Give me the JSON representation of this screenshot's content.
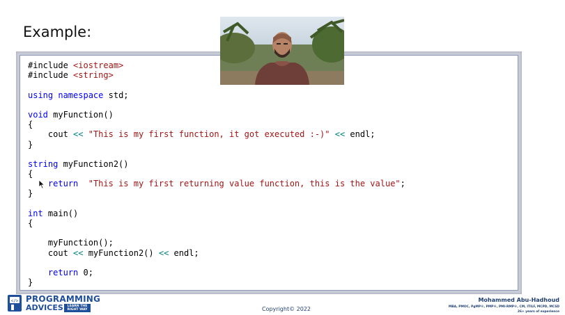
{
  "slide": {
    "title": "Example:"
  },
  "code": {
    "lines": [
      [
        {
          "t": "#include ",
          "c": "plain"
        },
        {
          "t": "<iostream>",
          "c": "str"
        }
      ],
      [
        {
          "t": "#include ",
          "c": "plain"
        },
        {
          "t": "<string>",
          "c": "str"
        }
      ],
      [],
      [
        {
          "t": "using",
          "c": "kw"
        },
        {
          "t": " ",
          "c": "plain"
        },
        {
          "t": "namespace",
          "c": "kw"
        },
        {
          "t": " std;",
          "c": "plain"
        }
      ],
      [],
      [
        {
          "t": "void",
          "c": "kw"
        },
        {
          "t": " myFunction()",
          "c": "plain"
        }
      ],
      [
        {
          "t": "{",
          "c": "plain"
        }
      ],
      [
        {
          "t": "    cout ",
          "c": "plain"
        },
        {
          "t": "<<",
          "c": "op"
        },
        {
          "t": " ",
          "c": "plain"
        },
        {
          "t": "\"This is my first function, it got executed :-)\"",
          "c": "str"
        },
        {
          "t": " ",
          "c": "plain"
        },
        {
          "t": "<<",
          "c": "op"
        },
        {
          "t": " endl;",
          "c": "plain"
        }
      ],
      [
        {
          "t": "}",
          "c": "plain"
        }
      ],
      [],
      [
        {
          "t": "string",
          "c": "kw"
        },
        {
          "t": " myFunction2()",
          "c": "plain"
        }
      ],
      [
        {
          "t": "{",
          "c": "plain"
        }
      ],
      [
        {
          "t": "    ",
          "c": "plain"
        },
        {
          "t": "return",
          "c": "kw"
        },
        {
          "t": "  ",
          "c": "plain"
        },
        {
          "t": "\"This is my first returning value function, this is the value\"",
          "c": "str"
        },
        {
          "t": ";",
          "c": "plain"
        }
      ],
      [
        {
          "t": "}",
          "c": "plain"
        }
      ],
      [],
      [
        {
          "t": "int",
          "c": "kw"
        },
        {
          "t": " main()",
          "c": "plain"
        }
      ],
      [
        {
          "t": "{",
          "c": "plain"
        }
      ],
      [],
      [
        {
          "t": "    myFunction();",
          "c": "plain"
        }
      ],
      [
        {
          "t": "    cout ",
          "c": "plain"
        },
        {
          "t": "<<",
          "c": "op"
        },
        {
          "t": " myFunction2() ",
          "c": "plain"
        },
        {
          "t": "<<",
          "c": "op"
        },
        {
          "t": " endl;",
          "c": "plain"
        }
      ],
      [],
      [
        {
          "t": "    ",
          "c": "plain"
        },
        {
          "t": "return",
          "c": "kw"
        },
        {
          "t": " 0;",
          "c": "plain"
        }
      ],
      [
        {
          "t": "}",
          "c": "plain"
        }
      ]
    ]
  },
  "footer": {
    "logo_line1": "PROGRAMMING",
    "logo_line2": "ADVICES",
    "logo_tagline": "LEARN THE RIGHT WAY",
    "copyright": "Copyright© 2022",
    "author_name": "Mohammed Abu-Hadhoud",
    "author_credentials": "MBA, PMOC, PgMP®, PMP®, PMI-RMP®, CM, ITILF, MCPD, MCSD",
    "author_experience": "26+ years of experience"
  },
  "icons": {
    "cursor": "mouse-pointer-icon",
    "logo_mark": "programming-advices-logo-icon",
    "presenter": "presenter-video"
  },
  "colors": {
    "keyword": "#0000ff",
    "string": "#a31515",
    "operator": "#008080",
    "brand": "#1f4e9a"
  }
}
